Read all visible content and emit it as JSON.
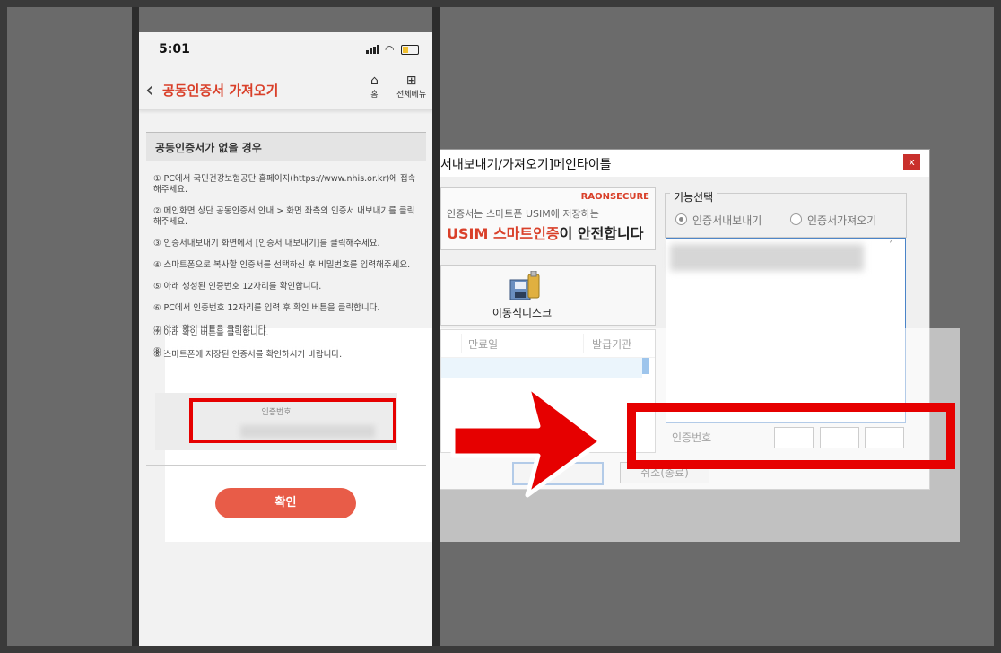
{
  "phone": {
    "status": {
      "time": "5:01"
    },
    "header": {
      "title": "공동인증서 가져오기",
      "home_label": "홈",
      "menu_label": "전체메뉴"
    },
    "section_title": "공동인증서가 없을 경우",
    "steps": [
      "① PC에서 국민건강보험공단 홈페이지(https://www.nhis.or.kr)에 접속해주세요.",
      "② 메인화면 상단 공동인증서 안내 > 화면 좌측의 인증서 내보내기를 클릭해주세요.",
      "③ 인증서내보내기 화면에서 [인증서 내보내기]를 클릭해주세요.",
      "④ 스마트폰으로 복사할 인증서를 선택하신 후 비밀번호를 입력해주세요.",
      "⑤ 아래 생성된 인증번호 12자리를 확인합니다.",
      "⑥ PC에서 인증번호 12자리를 입력 후 확인 버튼을 클릭합니다.",
      "⑦ 아래 확인 버튼을 클릭합니다.",
      "⑧ 스마트폰에 저장된 인증서를 확인하시기 바랍니다."
    ],
    "code_label": "인증번호",
    "code_value": "0000-0000-0000",
    "confirm_label": "확인"
  },
  "dialog": {
    "title": "서내보내기/가져오기]메인타이틀",
    "close_label": "x",
    "banner": {
      "brand": "RAONSECURE",
      "subtitle": "인증서는 스마트폰 USIM에 저장하는",
      "headline_highlight": "USIM 스마트인증",
      "headline_rest": "이 안전합니다"
    },
    "disk_label": "이동식디스크",
    "list_columns": [
      "만료일",
      "발급기관"
    ],
    "function_group": {
      "legend": "기능선택",
      "options": [
        {
          "label": "인증서내보내기",
          "selected": true
        },
        {
          "label": "인증서가져오기",
          "selected": false
        }
      ]
    },
    "code_label": "인증번호",
    "buttons": {
      "ok": "",
      "cancel": "취소(종료)"
    }
  },
  "colors": {
    "accent_red": "#e60000",
    "title_red": "#d9402a",
    "confirm_button": "#e85c48",
    "selection_blue": "#1a75d2"
  },
  "icons": [
    "back-chevron-icon",
    "home-icon",
    "grid-menu-icon",
    "signal-icon",
    "wifi-icon",
    "battery-icon",
    "close-icon",
    "removable-disk-icon",
    "arrow-right-icon"
  ]
}
